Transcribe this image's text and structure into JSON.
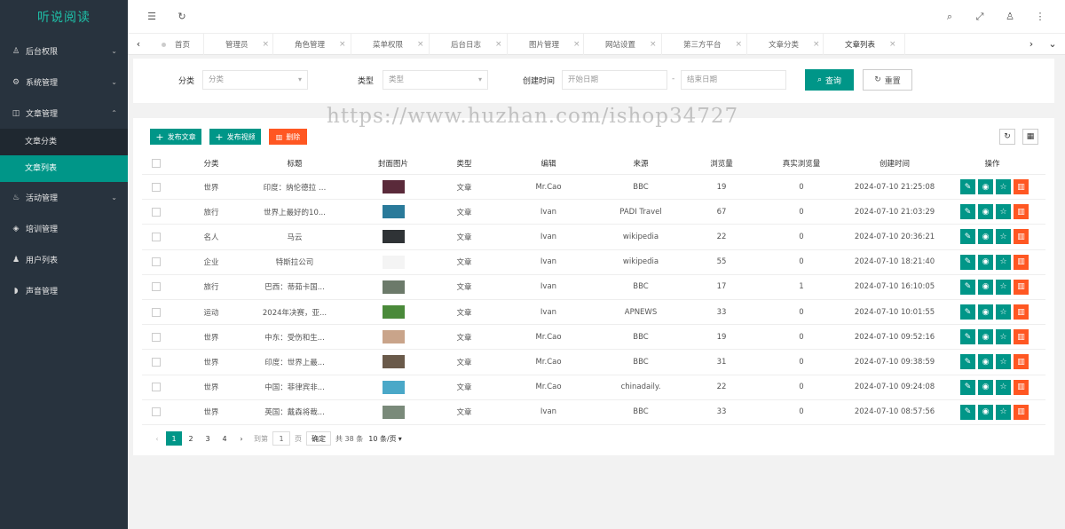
{
  "app": {
    "brand": "听说阅读"
  },
  "colors": {
    "accent": "#009688",
    "danger": "#ff5722",
    "sidebar": "#28333e",
    "brand_text": "#1ec0a8"
  },
  "sidebar": {
    "items": [
      {
        "label": "后台权限",
        "icon": "user-icon",
        "arrow": "chevron-down-icon"
      },
      {
        "label": "系统管理",
        "icon": "gear-icon",
        "arrow": "chevron-down-icon"
      },
      {
        "label": "文章管理",
        "icon": "book-icon",
        "arrow": "chevron-up-icon"
      },
      {
        "label": "活动管理",
        "icon": "fire-icon",
        "arrow": "chevron-down-icon"
      },
      {
        "label": "培训管理",
        "icon": "diamond-icon"
      },
      {
        "label": "用户列表",
        "icon": "users-icon"
      },
      {
        "label": "声音管理",
        "icon": "sound-icon"
      }
    ],
    "subitems": [
      {
        "label": "文章分类"
      },
      {
        "label": "文章列表"
      }
    ]
  },
  "topbar": {
    "icons": [
      "menu-fold-icon",
      "refresh-icon",
      "search-icon",
      "fullscreen-icon",
      "user-icon",
      "more-icon"
    ]
  },
  "tabs": [
    {
      "label": "首页"
    },
    {
      "label": "管理员"
    },
    {
      "label": "角色管理"
    },
    {
      "label": "菜单权限"
    },
    {
      "label": "后台日志"
    },
    {
      "label": "图片管理"
    },
    {
      "label": "网站设置"
    },
    {
      "label": "第三方平台"
    },
    {
      "label": "文章分类"
    },
    {
      "label": "文章列表"
    }
  ],
  "search": {
    "category_label": "分类",
    "category_value": "分类",
    "type_label": "类型",
    "type_value": "类型",
    "created_label": "创建时间",
    "start_placeholder": "开始日期",
    "range_sep": "-",
    "end_placeholder": "结束日期",
    "query_label": "查询",
    "reset_label": "重置"
  },
  "toolbar": {
    "publish_article": "发布文章",
    "publish_video": "发布视频",
    "delete": "删除"
  },
  "table": {
    "headers": [
      "分类",
      "标题",
      "封面图片",
      "类型",
      "编辑",
      "来源",
      "浏览量",
      "真实浏览量",
      "创建时间",
      "操作"
    ],
    "rows": [
      {
        "category": "世界",
        "title": "印度：纳伦德拉 …",
        "cover": "#5a2a3a",
        "type": "文章",
        "editor": "Mr.Cao",
        "source": "BBC",
        "views": "19",
        "real": "0",
        "created": "2024-07-10 21:25:08"
      },
      {
        "category": "旅行",
        "title": "世界上最好的10...",
        "cover": "#2a7a9a",
        "type": "文章",
        "editor": "Ivan",
        "source": "PADI Travel",
        "views": "67",
        "real": "0",
        "created": "2024-07-10 21:03:29"
      },
      {
        "category": "名人",
        "title": "马云",
        "cover": "#2f3336",
        "type": "文章",
        "editor": "Ivan",
        "source": "wikipedia",
        "views": "22",
        "real": "0",
        "created": "2024-07-10 20:36:21"
      },
      {
        "category": "企业",
        "title": "特斯拉公司",
        "cover": "#f4f4f4",
        "type": "文章",
        "editor": "Ivan",
        "source": "wikipedia",
        "views": "55",
        "real": "0",
        "created": "2024-07-10 18:21:40"
      },
      {
        "category": "旅行",
        "title": "巴西：蒂茹卡国...",
        "cover": "#6c7a6a",
        "type": "文章",
        "editor": "Ivan",
        "source": "BBC",
        "views": "17",
        "real": "1",
        "created": "2024-07-10 16:10:05"
      },
      {
        "category": "运动",
        "title": "2024年决赛，亚...",
        "cover": "#4a8a3a",
        "type": "文章",
        "editor": "Ivan",
        "source": "APNEWS",
        "views": "33",
        "real": "0",
        "created": "2024-07-10 10:01:55"
      },
      {
        "category": "世界",
        "title": "中东：受伤和生...",
        "cover": "#c9a48a",
        "type": "文章",
        "editor": "Mr.Cao",
        "source": "BBC",
        "views": "19",
        "real": "0",
        "created": "2024-07-10 09:52:16"
      },
      {
        "category": "世界",
        "title": "印度：世界上最...",
        "cover": "#6a5a4a",
        "type": "文章",
        "editor": "Mr.Cao",
        "source": "BBC",
        "views": "31",
        "real": "0",
        "created": "2024-07-10 09:38:59"
      },
      {
        "category": "世界",
        "title": "中国：菲律宾非...",
        "cover": "#4aa8c8",
        "type": "文章",
        "editor": "Mr.Cao",
        "source": "chinadaily.",
        "views": "22",
        "real": "0",
        "created": "2024-07-10 09:24:08"
      },
      {
        "category": "世界",
        "title": "英国：戴森将裁...",
        "cover": "#7a8a7a",
        "type": "文章",
        "editor": "Ivan",
        "source": "BBC",
        "views": "33",
        "real": "0",
        "created": "2024-07-10 08:57:56"
      }
    ]
  },
  "pagination": {
    "pages": [
      "1",
      "2",
      "3",
      "4"
    ],
    "goto_label": "到第",
    "goto_value": "1",
    "page_unit": "页",
    "confirm_label": "确定",
    "total_label": "共 38 条",
    "page_size_label": "10 条/页"
  },
  "watermark": "https://www.huzhan.com/ishop34727"
}
